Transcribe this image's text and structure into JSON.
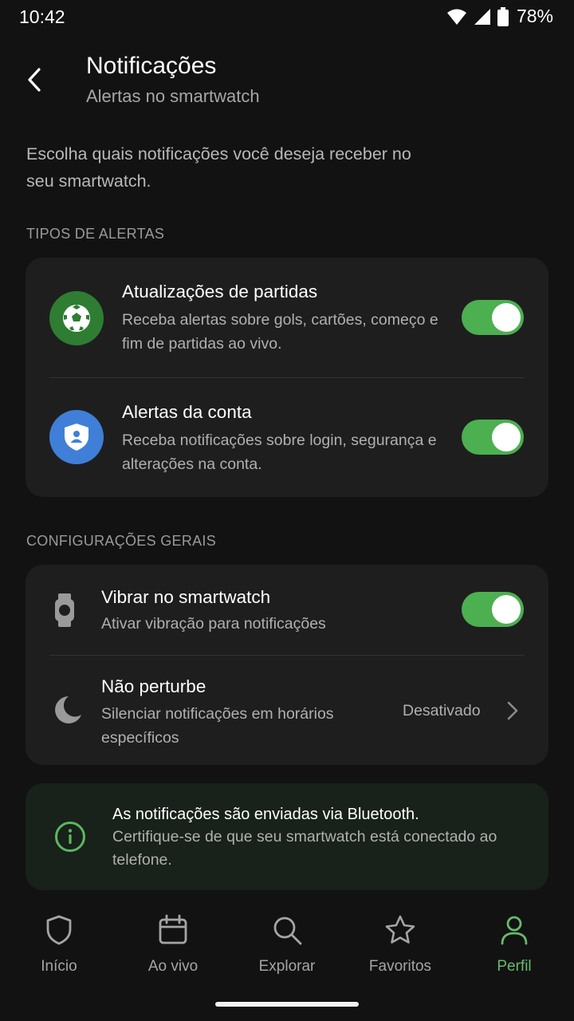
{
  "status_bar": {
    "time": "10:42",
    "battery": "78%"
  },
  "header": {
    "title": "Notificações",
    "subtitle": "Alertas no smartwatch"
  },
  "intro": "Escolha quais notificações você deseja receber no seu smartwatch.",
  "sections": {
    "alert_types": {
      "label": "TIPOS DE ALERTAS",
      "items": [
        {
          "title": "Atualizações de partidas",
          "description": "Receba alertas sobre gols, cartões, começo e fim de partidas ao vivo.",
          "icon": "soccer-ball-icon",
          "enabled": true
        },
        {
          "title": "Alertas da conta",
          "description": "Receba notificações sobre login, segurança e alterações na conta.",
          "icon": "shield-user-icon",
          "enabled": true
        }
      ]
    },
    "general": {
      "label": "CONFIGURAÇÕES GERAIS",
      "items": [
        {
          "title": "Vibrar no smartwatch",
          "description": "Ativar vibração para notificações",
          "icon": "watch-icon",
          "enabled": true
        },
        {
          "title": "Não perturbe",
          "description": "Silenciar notificações em horários específicos",
          "icon": "moon-icon",
          "value": "Desativado"
        }
      ]
    }
  },
  "info": {
    "title": "As notificações são enviadas via Bluetooth.",
    "description": "Certifique-se de que seu smartwatch está conectado ao telefone.",
    "icon": "info-icon"
  },
  "bottom_nav": [
    {
      "label": "Início",
      "icon": "shield-icon",
      "active": false
    },
    {
      "label": "Ao vivo",
      "icon": "calendar-icon",
      "active": false
    },
    {
      "label": "Explorar",
      "icon": "search-icon",
      "active": false
    },
    {
      "label": "Favoritos",
      "icon": "star-icon",
      "active": false
    },
    {
      "label": "Perfil",
      "icon": "person-icon",
      "active": true
    }
  ],
  "colors": {
    "background": "#121212",
    "card": "#1e1e1f",
    "accent_green": "#4caf50",
    "active_nav": "#66bb6a",
    "soccer_icon_bg": "#2e7d32",
    "account_icon_bg": "#3f7fd8"
  }
}
